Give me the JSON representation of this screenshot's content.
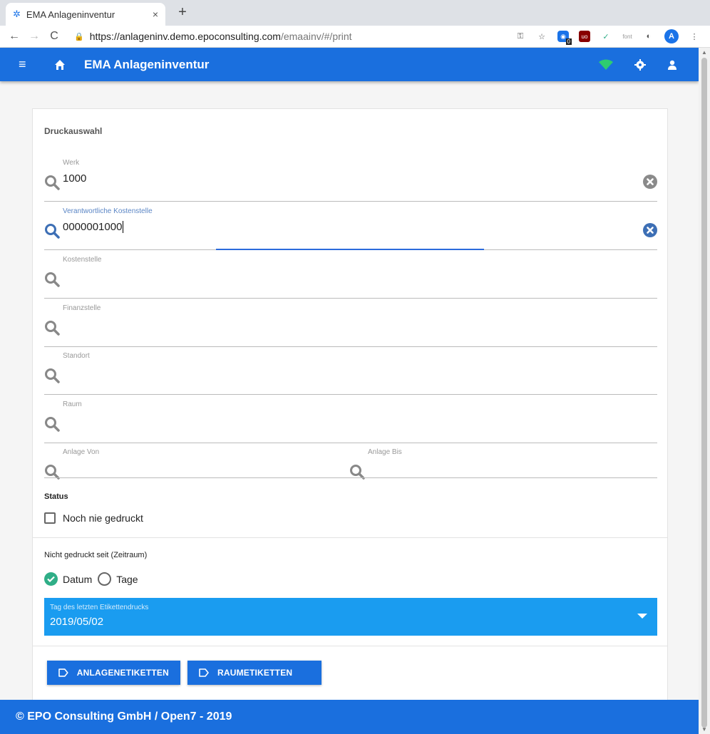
{
  "browser": {
    "tab_title": "EMA Anlageninventur",
    "tab_close": "×",
    "new_tab": "+",
    "url_host": "https://anlageninv.demo.epoconsulting.com",
    "url_path": "/emaainv/#/print",
    "ghost_badge": "0",
    "font_ext": "font",
    "profile_initial": "A"
  },
  "app": {
    "title": "EMA Anlageninventur",
    "accent_color": "#1a6fde",
    "online_indicator_color": "#2ecc71"
  },
  "form": {
    "section_title": "Druckauswahl",
    "fields": [
      {
        "label": "Werk",
        "value": "1000"
      },
      {
        "label": "Verantwortliche Kostenstelle",
        "value": "0000001000"
      },
      {
        "label": "Kostenstelle",
        "value": ""
      },
      {
        "label": "Finanzstelle",
        "value": ""
      },
      {
        "label": "Standort",
        "value": ""
      },
      {
        "label": "Raum",
        "value": ""
      }
    ],
    "anlage_von_label": "Anlage Von",
    "anlage_bis_label": "Anlage Bis",
    "status_title": "Status",
    "checkbox_label": "Noch nie gedruckt",
    "checkbox_checked": false,
    "period_title": "Nicht gedruckt seit (Zeitraum)",
    "radio_options": [
      "Datum",
      "Tage"
    ],
    "radio_selected": "Datum",
    "date_select": {
      "label": "Tag des letzten Etikettendrucks",
      "value": "2019/05/02"
    }
  },
  "buttons": {
    "asset_labels": "ANLAGENETIKETTEN",
    "room_labels": "RAUMETIKETTEN"
  },
  "footer": {
    "text": "© EPO Consulting GmbH / Open7 - 2019"
  }
}
